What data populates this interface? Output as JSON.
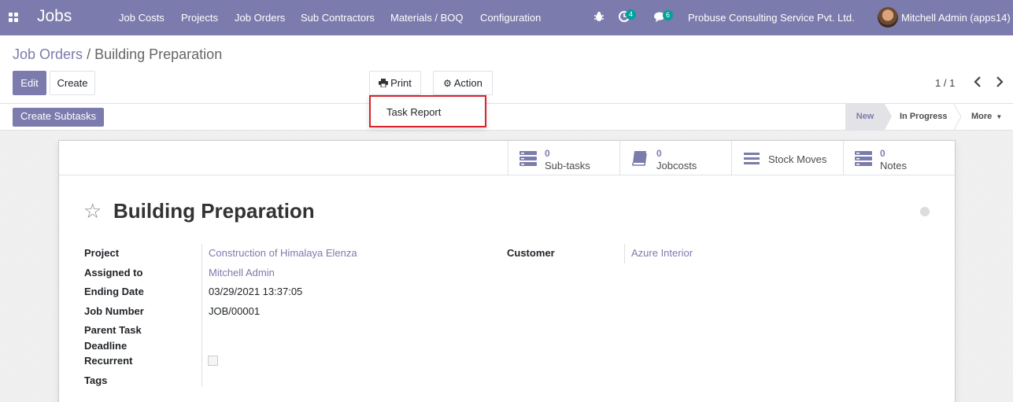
{
  "navbar": {
    "brand": "Jobs",
    "menu": [
      "Job Costs",
      "Projects",
      "Job Orders",
      "Sub Contractors",
      "Materials / BOQ",
      "Configuration"
    ],
    "activity_count": "4",
    "message_count": "6",
    "company": "Probuse Consulting Service Pvt. Ltd.",
    "user": "Mitchell Admin (apps14)"
  },
  "breadcrumb": {
    "parent": "Job Orders",
    "separator": "/",
    "current": "Building Preparation"
  },
  "buttons": {
    "edit": "Edit",
    "create": "Create",
    "print": "Print",
    "action": "Action",
    "create_subtasks": "Create Subtasks"
  },
  "print_menu": {
    "items": [
      "Task Report"
    ]
  },
  "pager": {
    "value": "1 / 1"
  },
  "stages": {
    "new": "New",
    "in_progress": "In Progress",
    "more": "More"
  },
  "smart_buttons": [
    {
      "count": "0",
      "label": "Sub-tasks"
    },
    {
      "count": "0",
      "label": "Jobcosts"
    },
    {
      "count": "",
      "label": "Stock Moves"
    },
    {
      "count": "0",
      "label": "Notes"
    }
  ],
  "record": {
    "title": "Building Preparation",
    "fields": {
      "project_label": "Project",
      "project": "Construction of Himalaya Elenza",
      "assigned_label": "Assigned to",
      "assigned": "Mitchell Admin",
      "ending_label": "Ending Date",
      "ending": "03/29/2021 13:37:05",
      "job_number_label": "Job Number",
      "job_number": "JOB/00001",
      "parent_label": "Parent Task",
      "deadline_label": "Deadline",
      "recurrent_label": "Recurrent",
      "tags_label": "Tags",
      "customer_label": "Customer",
      "customer": "Azure Interior"
    }
  },
  "colors": {
    "brand": "#7c7bad",
    "highlight_border": "#d9232d",
    "badge": "#00a09d"
  }
}
